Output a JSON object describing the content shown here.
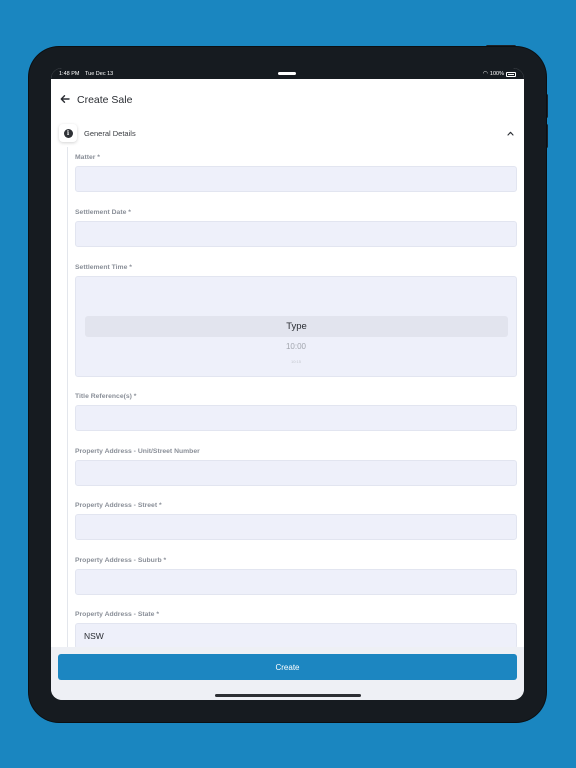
{
  "status_bar": {
    "time": "1:48 PM",
    "date": "Tue Dec 13",
    "battery": "100%"
  },
  "header": {
    "title": "Create Sale"
  },
  "section": {
    "title": "General Details",
    "expanded": true
  },
  "fields": [
    {
      "label": "Matter *",
      "value": ""
    },
    {
      "label": "Settlement Date *",
      "value": ""
    },
    {
      "label": "Settlement Time *",
      "picker_selected": "Type",
      "picker_next": "10:00",
      "picker_next2": "10:15"
    },
    {
      "label": "Title Reference(s) *",
      "value": ""
    },
    {
      "label": "Property Address - Unit/Street Number",
      "value": ""
    },
    {
      "label": "Property Address - Street *",
      "value": ""
    },
    {
      "label": "Property Address - Suburb *",
      "value": ""
    },
    {
      "label": "Property Address - State *",
      "value": "NSW"
    }
  ],
  "actions": {
    "create_label": "Create"
  },
  "colors": {
    "background": "#1a86c0",
    "accent": "#1c86c1",
    "input_bg": "#eef0fa"
  }
}
